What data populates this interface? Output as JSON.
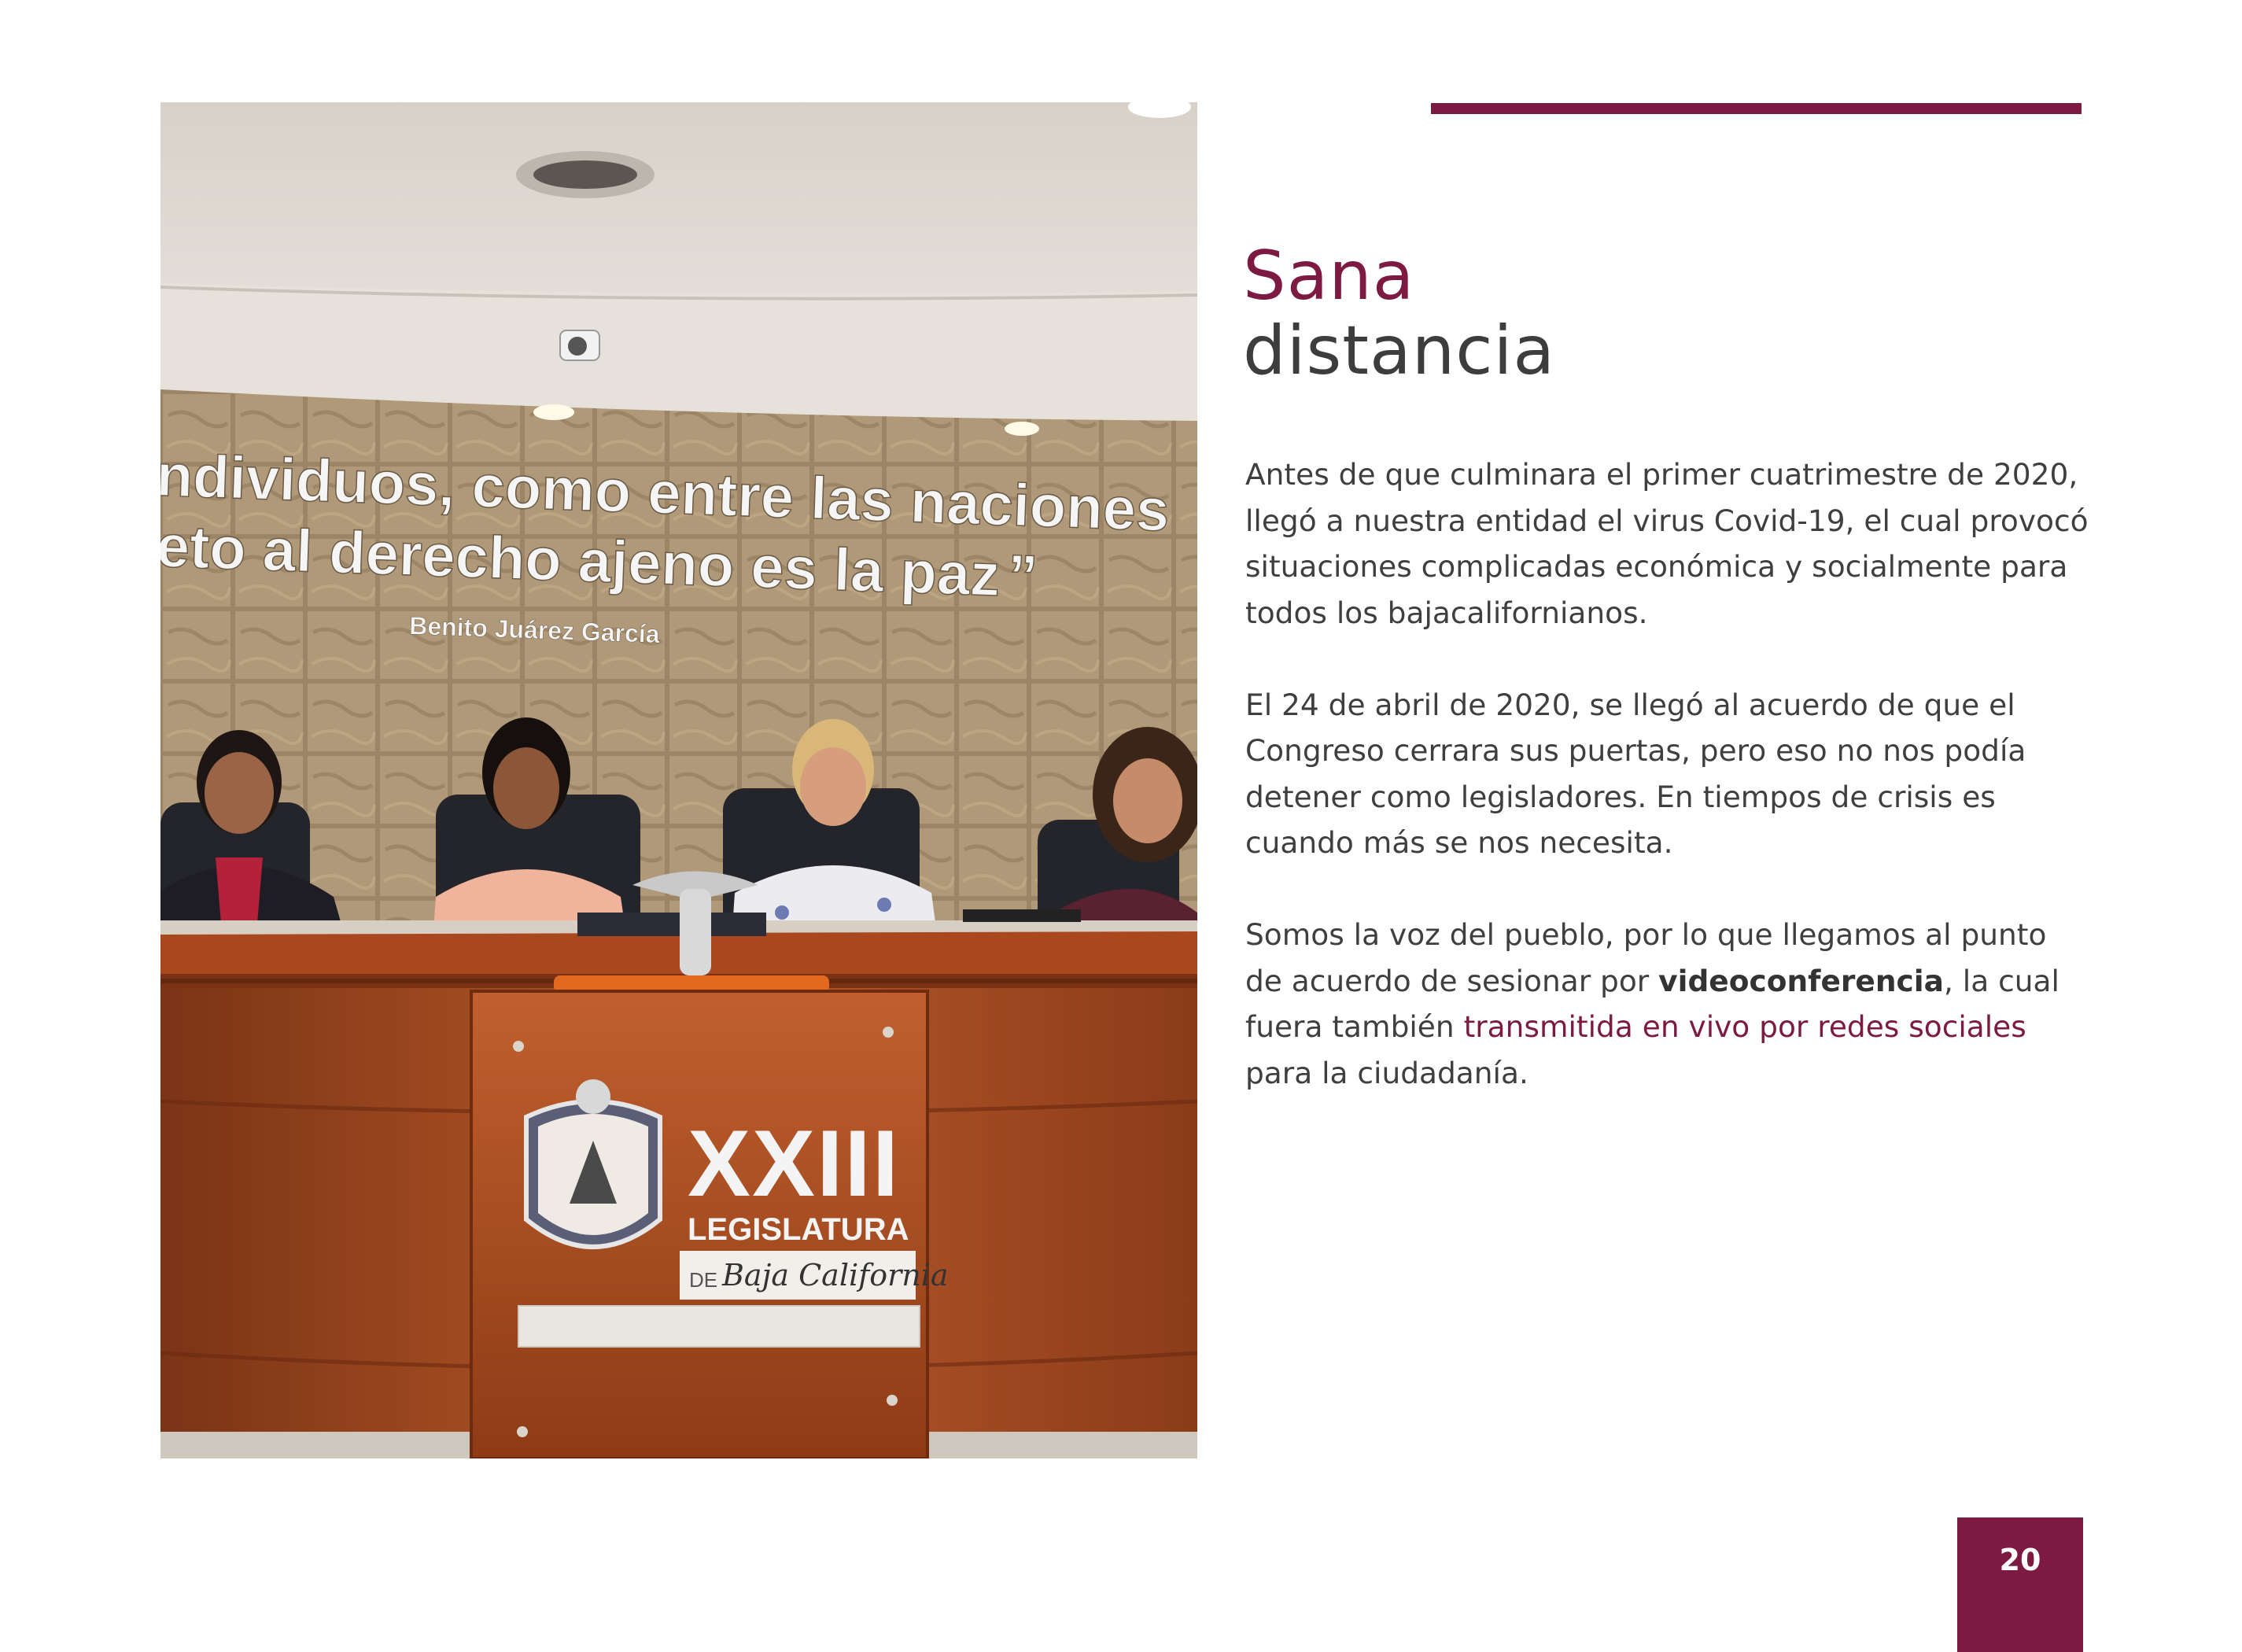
{
  "title": {
    "line1": "Sana",
    "line2": "distancia"
  },
  "paragraphs": {
    "p1": "Antes de que culminara el primer cuatrimestre de 2020, llegó a nuestra entidad el virus Covid-19, el cual provocó situaciones complicadas económica y socialmente para todos los bajacalifornianos.",
    "p2": "El 24 de abril de 2020, se llegó al acuerdo de que el Congreso cerrara sus puertas, pero eso no nos podía detener como legisladores. En tiempos de crisis es cuando más se nos necesita.",
    "p3_part1": "Somos la voz del pueblo, por lo que llegamos al punto de acuerdo de sesionar por ",
    "p3_bold": "videoconferencia",
    "p3_part2": ", la cual fuera también ",
    "p3_highlight": "transmitida en vivo por redes sociales",
    "p3_part3": " para la ciudadanía."
  },
  "photo": {
    "wall_quote_line1": "ndividuos, como entre las naciones",
    "wall_quote_line2": "eto al derecho ajeno es la paz",
    "wall_quote_close": "”",
    "wall_quote_author": "Benito Juárez García",
    "podium_numeral": "XXIII",
    "podium_legislatura": "LEGISLATURA",
    "podium_de": "DE",
    "podium_state": "Baja California"
  },
  "page_number": "20",
  "colors": {
    "accent": "#7d1a42",
    "text": "#3f3f3f",
    "title_dark": "#3d3d3d"
  }
}
